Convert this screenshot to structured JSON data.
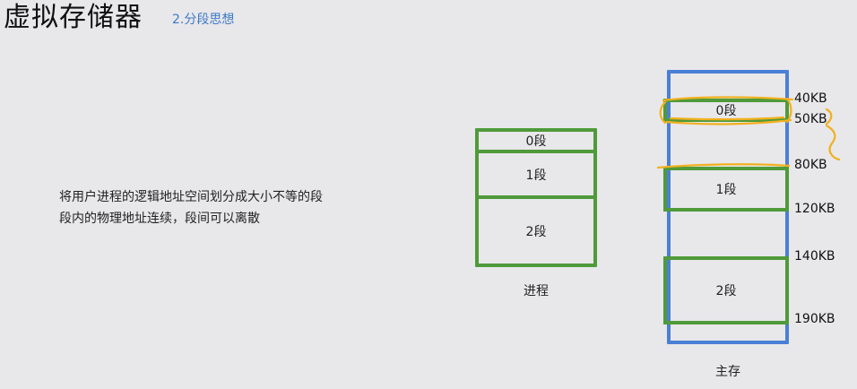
{
  "title": "虚拟存储器",
  "subtitle": "2.分段思想",
  "description": [
    "将用户进程的逻辑地址空间划分成大小不等的段",
    "段内的物理地址连续，段间可以离散"
  ],
  "process": {
    "label": "进程",
    "segments": [
      "0段",
      "1段",
      "2段"
    ]
  },
  "memory": {
    "label": "主存",
    "segments": [
      "0段",
      "1段",
      "2段"
    ],
    "addresses": [
      "40KB",
      "50KB",
      "80KB",
      "120KB",
      "140KB",
      "190KB"
    ]
  },
  "colors": {
    "segment_border": "#4f9a3a",
    "memory_border": "#4a7fd6",
    "annotation": "#f2b01e",
    "subtitle": "#3d7bc6"
  }
}
